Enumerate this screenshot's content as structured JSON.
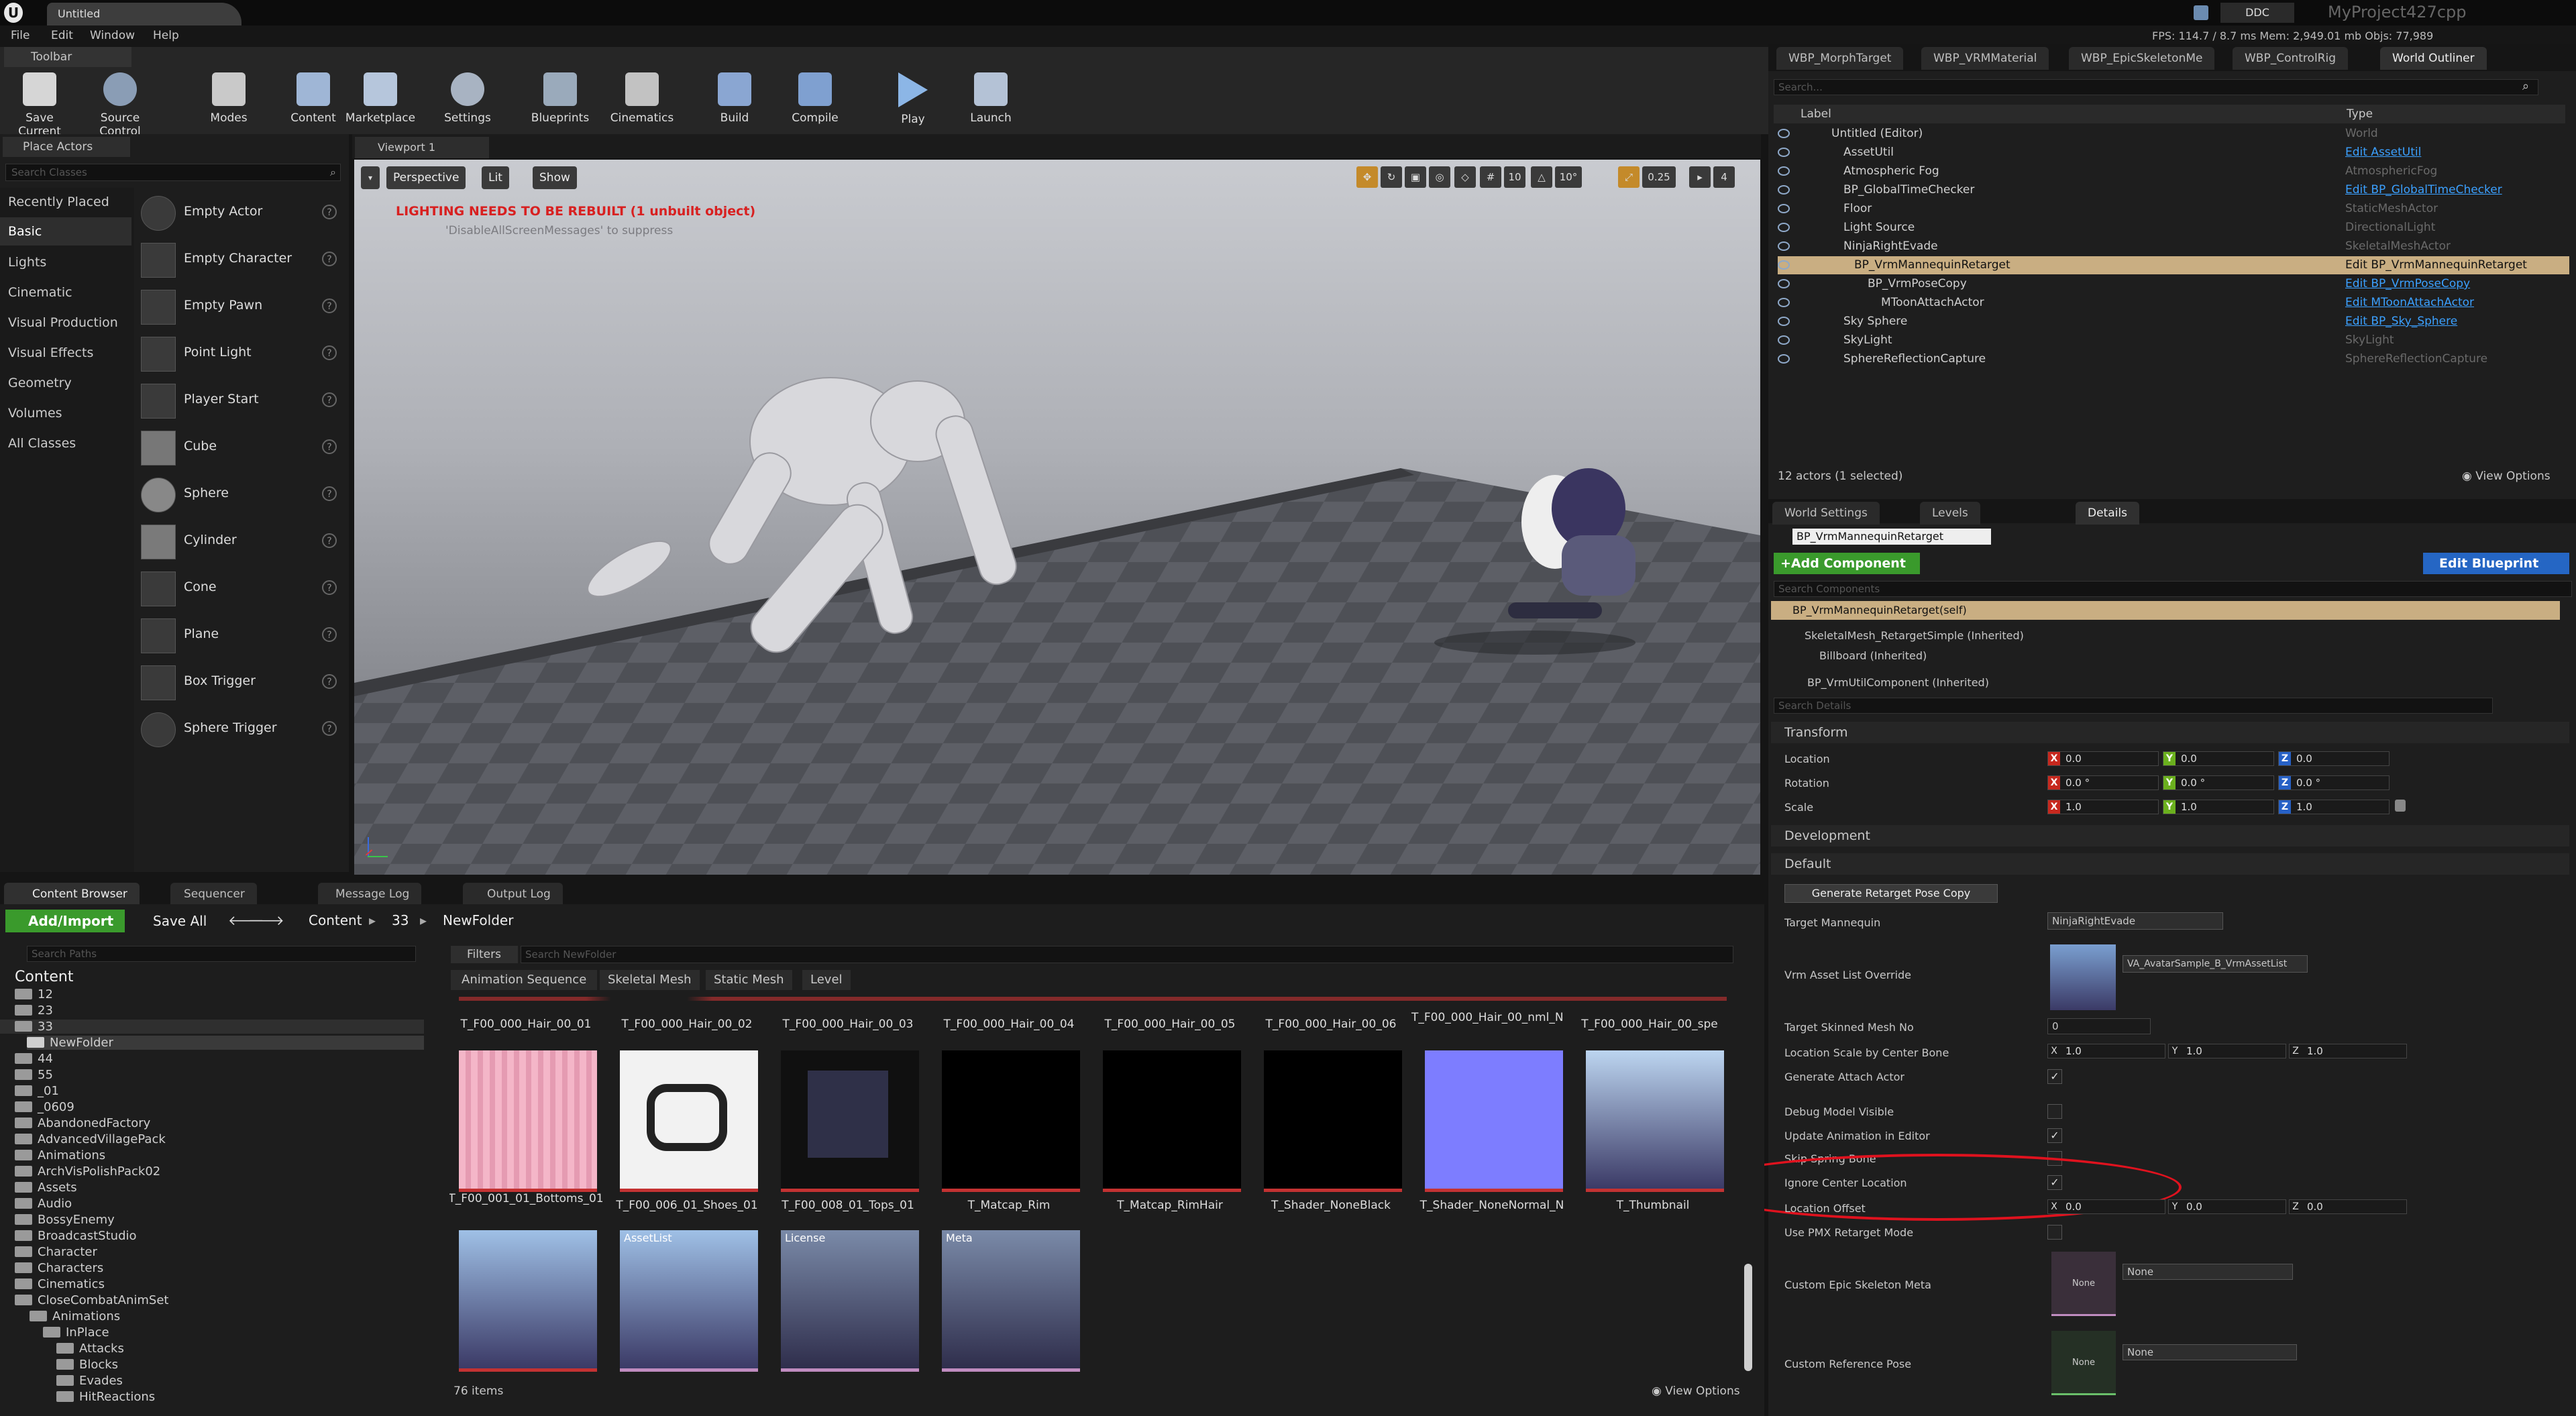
{
  "app": {
    "title_tab": "Untitled",
    "project": "MyProject427cpp",
    "ddc": "DDC",
    "stats": "FPS: 114.7  /  8.7 ms   Mem: 2,949.01 mb   Objs: 77,989"
  },
  "menu": [
    "File",
    "Edit",
    "Window",
    "Help"
  ],
  "toolbar": {
    "tab": "Toolbar",
    "buttons": [
      "Save Current",
      "Source Control",
      "Modes",
      "Content",
      "Marketplace",
      "Settings",
      "Blueprints",
      "Cinematics",
      "Build",
      "Compile",
      "Play",
      "Launch"
    ]
  },
  "place_actors": {
    "tab": "Place Actors",
    "search_placeholder": "Search Classes",
    "categories": [
      "Recently Placed",
      "Basic",
      "Lights",
      "Cinematic",
      "Visual Production",
      "Visual Effects",
      "Geometry",
      "Volumes",
      "All Classes"
    ],
    "items": [
      "Empty Actor",
      "Empty Character",
      "Empty Pawn",
      "Point Light",
      "Player Start",
      "Cube",
      "Sphere",
      "Cylinder",
      "Cone",
      "Plane",
      "Box Trigger",
      "Sphere Trigger"
    ]
  },
  "viewport": {
    "tab": "Viewport 1",
    "perspective": "Perspective",
    "lit": "Lit",
    "show": "Show",
    "warning": "LIGHTING NEEDS TO BE REBUILT (1 unbuilt object)",
    "suppress": "'DisableAllScreenMessages' to suppress",
    "snap_values": [
      "10",
      "10°",
      "0.25",
      "4"
    ]
  },
  "right_tabs": [
    "WBP_MorphTarget",
    "WBP_VRMMaterial",
    "WBP_EpicSkeletonMe",
    "WBP_ControlRig",
    "World Outliner"
  ],
  "outliner": {
    "search_placeholder": "Search...",
    "col_label": "Label",
    "col_type": "Type",
    "rows": [
      {
        "label": "Untitled (Editor)",
        "type": "World",
        "link": false
      },
      {
        "label": "AssetUtil",
        "type": "Edit AssetUtil",
        "link": true
      },
      {
        "label": "Atmospheric Fog",
        "type": "AtmosphericFog",
        "link": false
      },
      {
        "label": "BP_GlobalTimeChecker",
        "type": "Edit BP_GlobalTimeChecker",
        "link": true
      },
      {
        "label": "Floor",
        "type": "StaticMeshActor",
        "link": false
      },
      {
        "label": "Light Source",
        "type": "DirectionalLight",
        "link": false
      },
      {
        "label": "NinjaRightEvade",
        "type": "SkeletalMeshActor",
        "link": false
      },
      {
        "label": "BP_VrmMannequinRetarget",
        "type": "Edit BP_VrmMannequinRetarget",
        "link": true
      },
      {
        "label": "BP_VrmPoseCopy",
        "type": "Edit BP_VrmPoseCopy",
        "link": true
      },
      {
        "label": "MToonAttachActor",
        "type": "Edit MToonAttachActor",
        "link": true
      },
      {
        "label": "Sky Sphere",
        "type": "Edit BP_Sky_Sphere",
        "link": true
      },
      {
        "label": "SkyLight",
        "type": "SkyLight",
        "link": false
      },
      {
        "label": "SphereReflectionCapture",
        "type": "SphereReflectionCapture",
        "link": false
      }
    ],
    "footer": "12 actors (1 selected)",
    "view_options": "View Options"
  },
  "details": {
    "tabs": [
      "World Settings",
      "Levels",
      "Details"
    ],
    "actor_name": "BP_VrmMannequinRetarget",
    "add_component": "+Add Component",
    "edit_blueprint": "Edit Blueprint",
    "search_components": "Search Components",
    "components": [
      "BP_VrmMannequinRetarget(self)",
      "SkeletalMesh_RetargetSimple (Inherited)",
      "Billboard (Inherited)",
      "BP_VrmUtilComponent (Inherited)"
    ],
    "search_details": "Search Details",
    "sections": [
      "Transform",
      "Development",
      "Default"
    ],
    "location": {
      "label": "Location",
      "x": "0.0",
      "y": "0.0",
      "z": "0.0"
    },
    "rotation": {
      "label": "Rotation",
      "x": "0.0 °",
      "y": "0.0 °",
      "z": "0.0 °"
    },
    "scale": {
      "label": "Scale",
      "x": "1.0",
      "y": "1.0",
      "z": "1.0"
    },
    "generate_button": "Generate Retarget Pose Copy",
    "target_mannequin": {
      "label": "Target Mannequin",
      "value": "NinjaRightEvade"
    },
    "vrm_asset_list": {
      "label": "Vrm Asset List Override",
      "value": "VA_AvatarSample_B_VrmAssetList"
    },
    "target_skinned": {
      "label": "Target Skinned Mesh No",
      "value": "0"
    },
    "location_scale": {
      "label": "Location Scale by Center Bone",
      "x": "1.0",
      "y": "1.0",
      "z": "1.0"
    },
    "generate_attach": "Generate Attach Actor",
    "debug_visible": "Debug Model Visible",
    "update_anim": "Update Animation in Editor",
    "skip_spring": "Skip Spring Bone",
    "ignore_center": "Ignore Center Location",
    "location_offset": {
      "label": "Location Offset",
      "x": "0.0",
      "y": "0.0",
      "z": "0.0"
    },
    "use_pmx": "Use PMX Retarget Mode",
    "custom_epic": {
      "label": "Custom Epic Skeleton Meta",
      "value": "None"
    },
    "custom_ref": {
      "label": "Custom Reference Pose",
      "value": "None"
    },
    "thumb_none": "None"
  },
  "bottom_tabs": [
    "Content Browser",
    "Sequencer",
    "Message Log",
    "Output Log"
  ],
  "content_browser": {
    "add_import": "Add/Import",
    "save_all": "Save All",
    "path": [
      "Content",
      "33",
      "NewFolder"
    ],
    "search_paths": "Search Paths",
    "filters": "Filters",
    "search_folder": "Search NewFolder",
    "filter_chips": [
      "Animation Sequence",
      "Skeletal Mesh",
      "Static Mesh",
      "Level"
    ],
    "top_row": [
      "T_F00_000_Hair_00_01",
      "T_F00_000_Hair_00_02",
      "T_F00_000_Hair_00_03",
      "T_F00_000_Hair_00_04",
      "T_F00_000_Hair_00_05",
      "T_F00_000_Hair_00_06",
      "T_F00_000_Hair_00_nml_N",
      "T_F00_000_Hair_00_spe"
    ],
    "mid_row": [
      "T_F00_001_01_Bottoms_01",
      "T_F00_006_01_Shoes_01",
      "T_F00_008_01_Tops_01",
      "T_Matcap_Rim",
      "T_Matcap_RimHair",
      "T_Shader_NoneBlack",
      "T_Shader_NoneNormal_N",
      "T_Thumbnail"
    ],
    "bottom_row_badges": [
      "AssetList",
      "License",
      "Meta"
    ],
    "items_count": "76 items",
    "view_options": "View Options",
    "tree": [
      "Content",
      "12",
      "23",
      "33",
      "NewFolder",
      "44",
      "55",
      "_01",
      "_0609",
      "AbandonedFactory",
      "AdvancedVillagePack",
      "Animations",
      "ArchVisPolishPack02",
      "Assets",
      "Audio",
      "BossyEnemy",
      "BroadcastStudio",
      "Character",
      "Characters",
      "Cinematics",
      "CloseCombatAnimSet",
      "Animations",
      "InPlace",
      "Attacks",
      "Blocks",
      "Evades",
      "HitReactions"
    ]
  },
  "colors": {
    "accent_green": "#3a9a2c",
    "accent_blue": "#2566c4",
    "selection": "#c9ae82",
    "highlight_red": "#e0121e",
    "warning": "#d82020"
  }
}
